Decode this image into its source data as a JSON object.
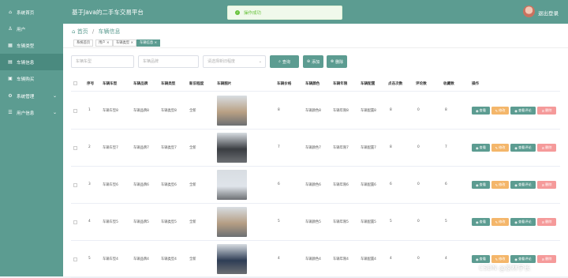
{
  "sidebar": {
    "items": [
      {
        "icon": "home-icon",
        "glyph": "⌂",
        "label": "系统首页",
        "arrow": ""
      },
      {
        "icon": "user-icon",
        "glyph": "♙",
        "label": "用户",
        "arrow": ""
      },
      {
        "icon": "car-type-icon",
        "glyph": "▦",
        "label": "车辆类型",
        "arrow": ""
      },
      {
        "icon": "car-info-icon",
        "glyph": "▤",
        "label": "车辆信息",
        "arrow": ""
      },
      {
        "icon": "car-buy-icon",
        "glyph": "▣",
        "label": "车辆购买",
        "arrow": ""
      },
      {
        "icon": "system-icon",
        "glyph": "⚙",
        "label": "系统管理",
        "arrow": "⌄"
      },
      {
        "icon": "user-info-icon",
        "glyph": "☰",
        "label": "用户信息",
        "arrow": "⌄"
      }
    ]
  },
  "header": {
    "title": "基于Java的二手车交易平台",
    "logout": "退出登录"
  },
  "toast": {
    "text": "操作成功",
    "check": "✓"
  },
  "breadcrumb": {
    "home_icon": "⌂",
    "home": "首页",
    "sep": "/",
    "current": "车辆信息"
  },
  "tags": [
    "系统首页",
    "用户 ×",
    "车辆类型 ×",
    "车辆信息 ×"
  ],
  "search": {
    "car_type_placeholder": "车辆车型",
    "car_brand_placeholder": "车辆品牌",
    "new_old_placeholder": "请选择新旧程度",
    "query_label": "查询",
    "add_label": "添加",
    "delete_label": "删除",
    "query_icon": "⌕",
    "add_icon": "⊕",
    "delete_icon": "⊗"
  },
  "table": {
    "headers": [
      "序号",
      "车辆车型",
      "车辆品牌",
      "车辆类型",
      "新旧程度",
      "车辆图片",
      "车辆价格",
      "车辆颜色",
      "车辆年限",
      "车辆配置",
      "点击次数",
      "评论数",
      "收藏数",
      "操作"
    ],
    "rows": [
      {
        "idx": "1",
        "model": "车辆车型8",
        "brand": "车辆品牌8",
        "type": "车辆类型8",
        "cond": "全新",
        "price": "8",
        "color": "车辆颜色8",
        "year": "车辆年限8",
        "config": "车辆配置8",
        "clicks": "8",
        "comments": "0",
        "favs": "8",
        "img_color": "#b9a084"
      },
      {
        "idx": "2",
        "model": "车辆车型7",
        "brand": "车辆品牌7",
        "type": "车辆类型7",
        "cond": "全新",
        "price": "7",
        "color": "车辆颜色7",
        "year": "车辆年限7",
        "config": "车辆配置7",
        "clicks": "8",
        "comments": "0",
        "favs": "7",
        "img_color": "#3a3d42"
      },
      {
        "idx": "3",
        "model": "车辆车型6",
        "brand": "车辆品牌6",
        "type": "车辆类型6",
        "cond": "全新",
        "price": "6",
        "color": "车辆颜色6",
        "year": "车辆年限6",
        "config": "车辆配置6",
        "clicks": "6",
        "comments": "0",
        "favs": "6",
        "img_color": "#dfe4ea"
      },
      {
        "idx": "4",
        "model": "车辆车型5",
        "brand": "车辆品牌5",
        "type": "车辆类型5",
        "cond": "全新",
        "price": "5",
        "color": "车辆颜色5",
        "year": "车辆年限5",
        "config": "车辆配置5",
        "clicks": "5",
        "comments": "0",
        "favs": "5",
        "img_color": "#b59e84"
      },
      {
        "idx": "5",
        "model": "车辆车型4",
        "brand": "车辆品牌4",
        "type": "车辆类型4",
        "cond": "全新",
        "price": "4",
        "color": "车辆颜色4",
        "year": "车辆年限4",
        "config": "车辆配置4",
        "clicks": "4",
        "comments": "0",
        "favs": "4",
        "img_color": "#2e3d55"
      }
    ],
    "actions": {
      "view": "查看",
      "edit": "修改",
      "review": "查看评论",
      "delete": "删除",
      "view_icon": "◉",
      "edit_icon": "✎",
      "review_icon": "◉",
      "delete_icon": "⊘"
    }
  },
  "watermark": "CSDN @家林学长"
}
